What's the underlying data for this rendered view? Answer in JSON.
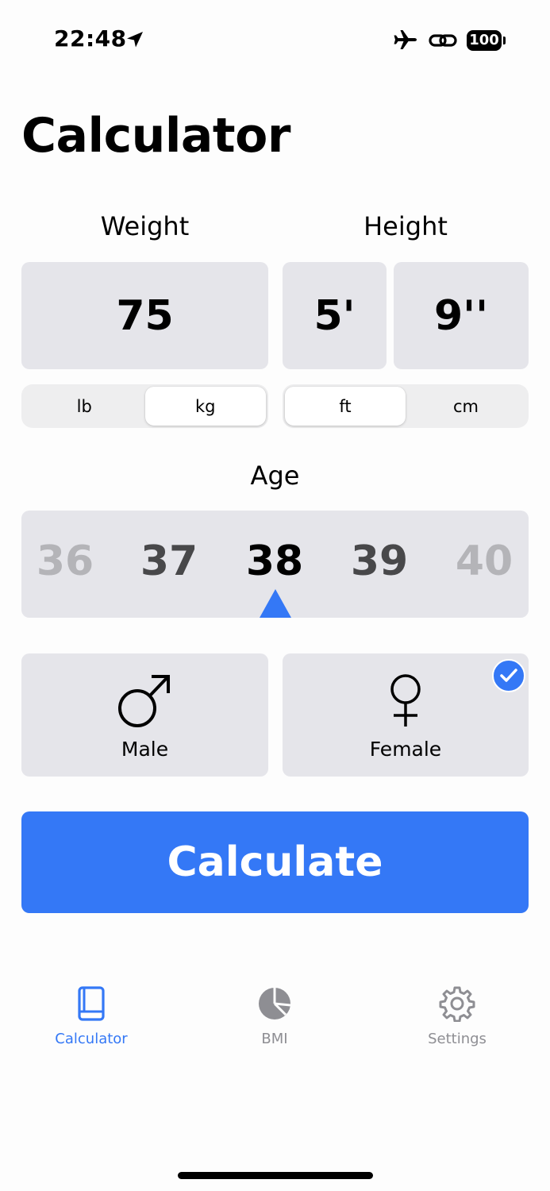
{
  "status_bar": {
    "time": "22:48",
    "battery": "100"
  },
  "title": "Calculator",
  "weight": {
    "label": "Weight",
    "value": "75",
    "units": [
      "lb",
      "kg"
    ],
    "selected_unit": "kg"
  },
  "height": {
    "label": "Height",
    "feet": "5'",
    "inches": "9''",
    "units": [
      "ft",
      "cm"
    ],
    "selected_unit": "ft"
  },
  "age": {
    "label": "Age",
    "options": [
      "36",
      "37",
      "38",
      "39",
      "40"
    ],
    "selected": "38"
  },
  "gender": {
    "male_label": "Male",
    "female_label": "Female",
    "selected": "Female"
  },
  "calculate_label": "Calculate",
  "tabs": [
    {
      "label": "Calculator",
      "icon": "book-icon",
      "active": true
    },
    {
      "label": "BMI",
      "icon": "pie-chart-icon",
      "active": false
    },
    {
      "label": "Settings",
      "icon": "gear-icon",
      "active": false
    }
  ],
  "colors": {
    "accent": "#3478f6",
    "card": "#e5e5ea",
    "inactive": "#8e8e93"
  }
}
